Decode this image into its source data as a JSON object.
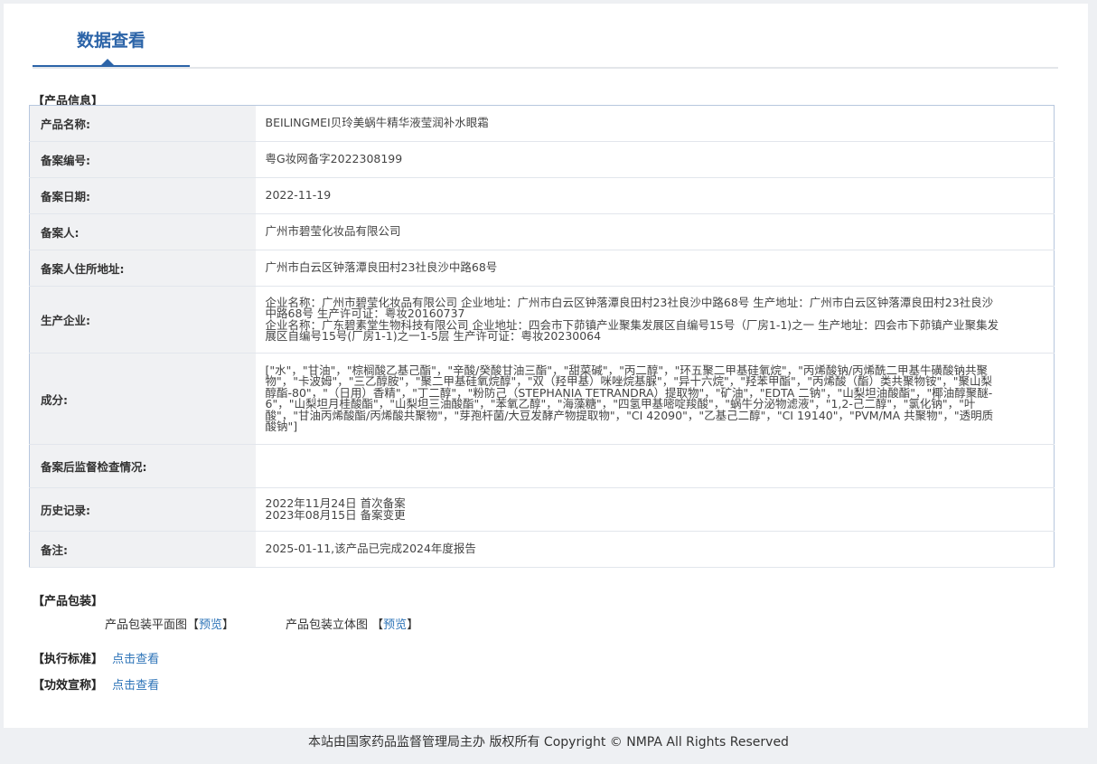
{
  "tab": {
    "title": "数据查看"
  },
  "sections": {
    "product_info": "【产品信息】",
    "product_package": "【产品包装】",
    "standard": "【执行标准】",
    "efficacy": "【功效宣称】"
  },
  "info_rows": [
    {
      "label": "产品名称:",
      "value": "BEILINGMEI贝玲美蜗牛精华液莹润补水眼霜"
    },
    {
      "label": "备案编号:",
      "value": "粤G妆网备字2022308199"
    },
    {
      "label": "备案日期:",
      "value": "2022-11-19"
    },
    {
      "label": "备案人:",
      "value": "广州市碧莹化妆品有限公司"
    },
    {
      "label": "备案人住所地址:",
      "value": "广州市白云区钟落潭良田村23社良沙中路68号"
    },
    {
      "label": "生产企业:",
      "value_lines": [
        "企业名称：广州市碧莹化妆品有限公司 企业地址：广州市白云区钟落潭良田村23社良沙中路68号 生产地址：广州市白云区钟落潭良田村23社良沙中路68号 生产许可证：粤妆20160737",
        "企业名称：广东碧素堂生物科技有限公司 企业地址：四会市下茆镇产业聚集发展区自编号15号（厂房1-1)之一 生产地址：四会市下茆镇产业聚集发展区自编号15号(厂房1-1)之一1-5层 生产许可证：粤妆20230064"
      ]
    },
    {
      "label": "成分:",
      "value": "[\"水\"，\"甘油\"，\"棕榈酸乙基己酯\"，\"辛酸/癸酸甘油三酯\"，\"甜菜碱\"，\"丙二醇\"，\"环五聚二甲基硅氧烷\"，\"丙烯酸钠/丙烯酰二甲基牛磺酸钠共聚物\"，\"卡波姆\"，\"三乙醇胺\"，\"聚二甲基硅氧烷醇\"，\"双（羟甲基）咪唑烷基脲\"，\"异十六烷\"，\"羟苯甲酯\"，\"丙烯酸（酯）类共聚物铵\"，\"聚山梨醇酯-80\"，\"（日用）香精\"，\"丁二醇\"，\"粉防己（STEPHANIA TETRANDRA）提取物\"，\"矿油\"，\"EDTA 二钠\"，\"山梨坦油酸酯\"，\"椰油醇聚醚-6\"，\"山梨坦月桂酸酯\"，\"山梨坦三油酸酯\"，\"苯氧乙醇\"，\"海藻糖\"，\"四氢甲基嘧啶羧酸\"，\"蜗牛分泌物滤液\"，\"1,2-己二醇\"，\"氯化钠\"，\"叶酸\"，\"甘油丙烯酸酯/丙烯酸共聚物\"，\"芽孢杆菌/大豆发酵产物提取物\"，\"CI 42090\"，\"乙基己二醇\"，\"CI 19140\"，\"PVM/MA 共聚物\"，\"透明质酸钠\"]"
    },
    {
      "label": "备案后监督检查情况:",
      "value": ""
    },
    {
      "label": "历史记录:",
      "value_lines": [
        "2022年11月24日 首次备案",
        "2023年08月15日 备案变更"
      ]
    },
    {
      "label": "备注:",
      "value": "2025-01-11,该产品已完成2024年度报告"
    }
  ],
  "package": {
    "flat_label": "产品包装平面图",
    "stereo_label": "产品包装立体图",
    "bracket_open": "【",
    "bracket_close": "】",
    "preview": "预览"
  },
  "links": {
    "view": "点击查看"
  },
  "footer": "本站由国家药品监督管理局主办 版权所有 Copyright © NMPA All Rights Reserved",
  "colors": {
    "accent": "#2c64a8",
    "link": "#2e74b8",
    "label_bg": "#f0f1f3",
    "table_border": "#b7c7de"
  }
}
